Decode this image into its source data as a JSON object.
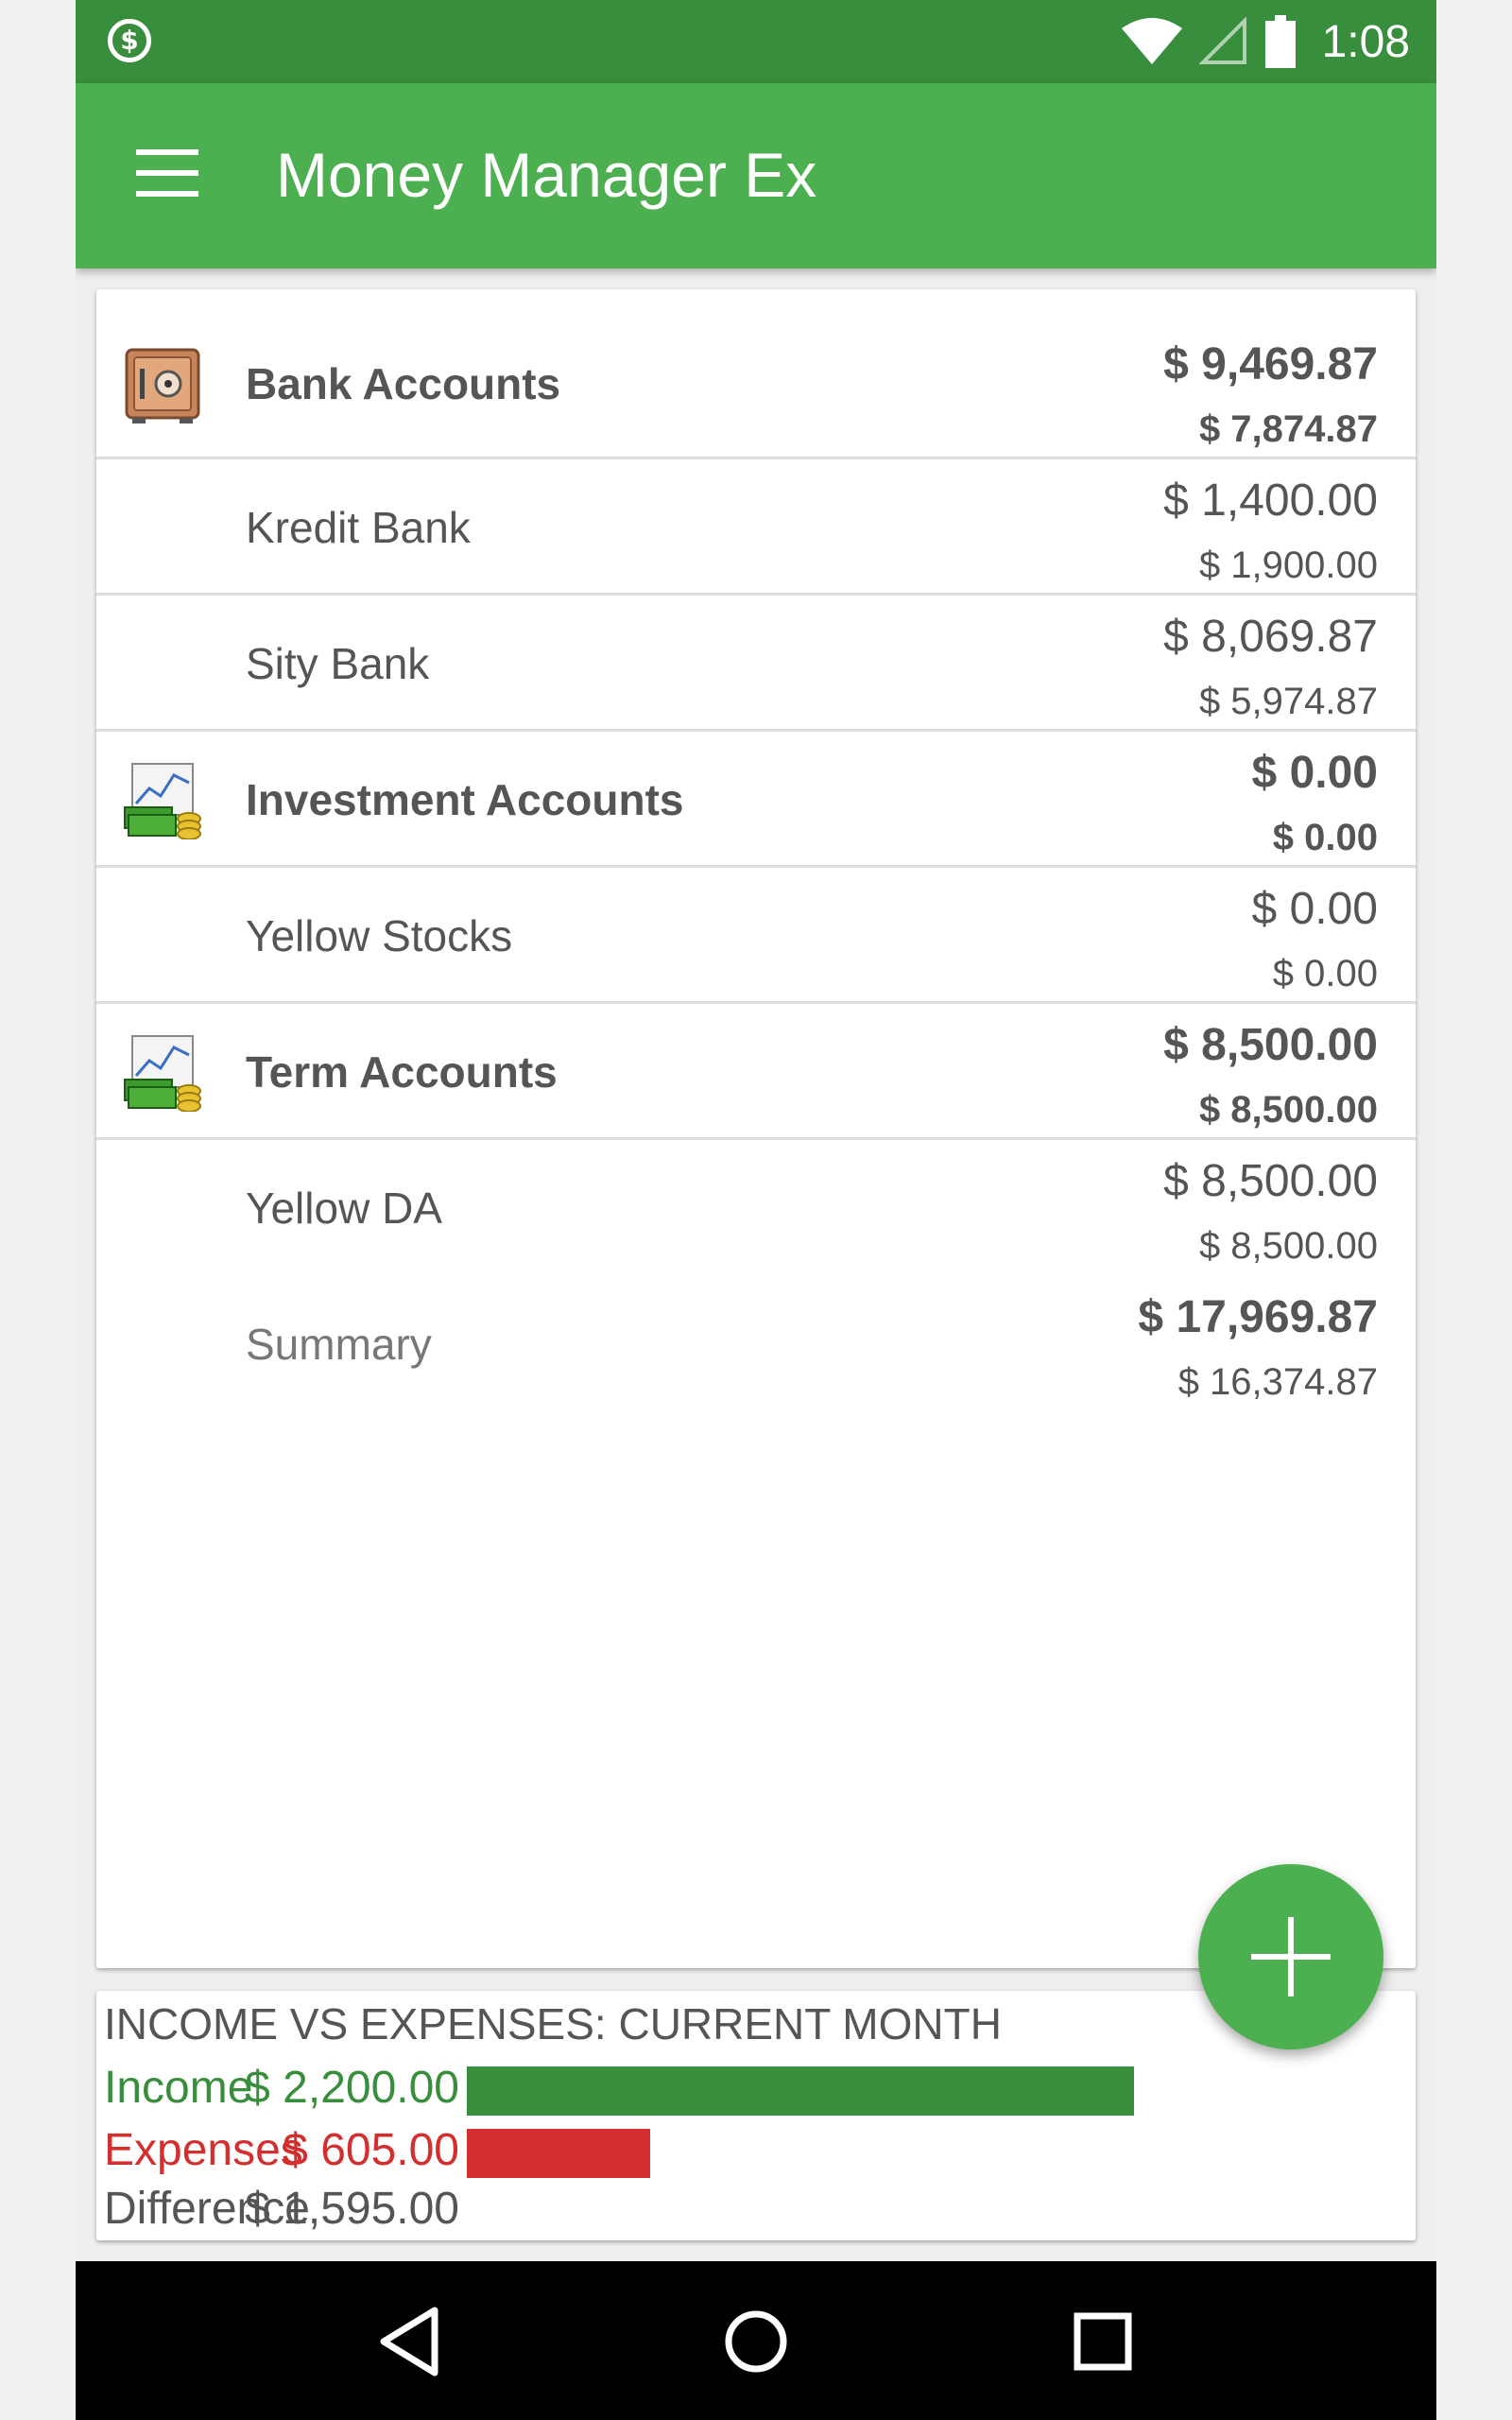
{
  "status_bar": {
    "time": "1:08",
    "app_icon_glyph": "$"
  },
  "toolbar": {
    "title": "Money Manager Ex"
  },
  "accounts": {
    "bank": {
      "label": "Bank Accounts",
      "amount": "$ 9,469.87",
      "sub_amount": "$ 7,874.87",
      "icon": "safe-icon"
    },
    "kredit": {
      "label": "Kredit Bank",
      "amount": "$ 1,400.00",
      "sub_amount": "$ 1,900.00"
    },
    "sity": {
      "label": "Sity Bank",
      "amount": "$ 8,069.87",
      "sub_amount": "$ 5,974.87"
    },
    "investment": {
      "label": "Investment Accounts",
      "amount": "$ 0.00",
      "sub_amount": "$ 0.00",
      "icon": "investment-chart-icon"
    },
    "yellow_stocks": {
      "label": "Yellow Stocks",
      "amount": "$ 0.00",
      "sub_amount": "$ 0.00"
    },
    "term": {
      "label": "Term Accounts",
      "amount": "$ 8,500.00",
      "sub_amount": "$ 8,500.00",
      "icon": "investment-chart-icon"
    },
    "yellow_da": {
      "label": "Yellow DA",
      "amount": "$ 8,500.00",
      "sub_amount": "$ 8,500.00"
    },
    "summary": {
      "label": "Summary",
      "amount": "$ 17,969.87",
      "sub_amount": "$ 16,374.87"
    }
  },
  "income_vs_expenses": {
    "title": "INCOME VS EXPENSES: CURRENT MONTH",
    "income_label": "Income",
    "income_value": "$ 2,200.00",
    "income_amount": 2200.0,
    "expenses_label": "Expenses",
    "expenses_value": "$ 605.00",
    "expenses_amount": 605.0,
    "difference_label": "Difference",
    "difference_value": "$ 1,595.00",
    "income_color": "#388e3c",
    "expenses_color": "#d32f2f"
  },
  "colors": {
    "primary": "#4caf50",
    "primary_dark": "#388e3c"
  },
  "icons": {
    "fab": "plus-icon",
    "nav_back": "back-triangle-icon",
    "nav_home": "home-circle-icon",
    "nav_recents": "recents-square-icon"
  }
}
